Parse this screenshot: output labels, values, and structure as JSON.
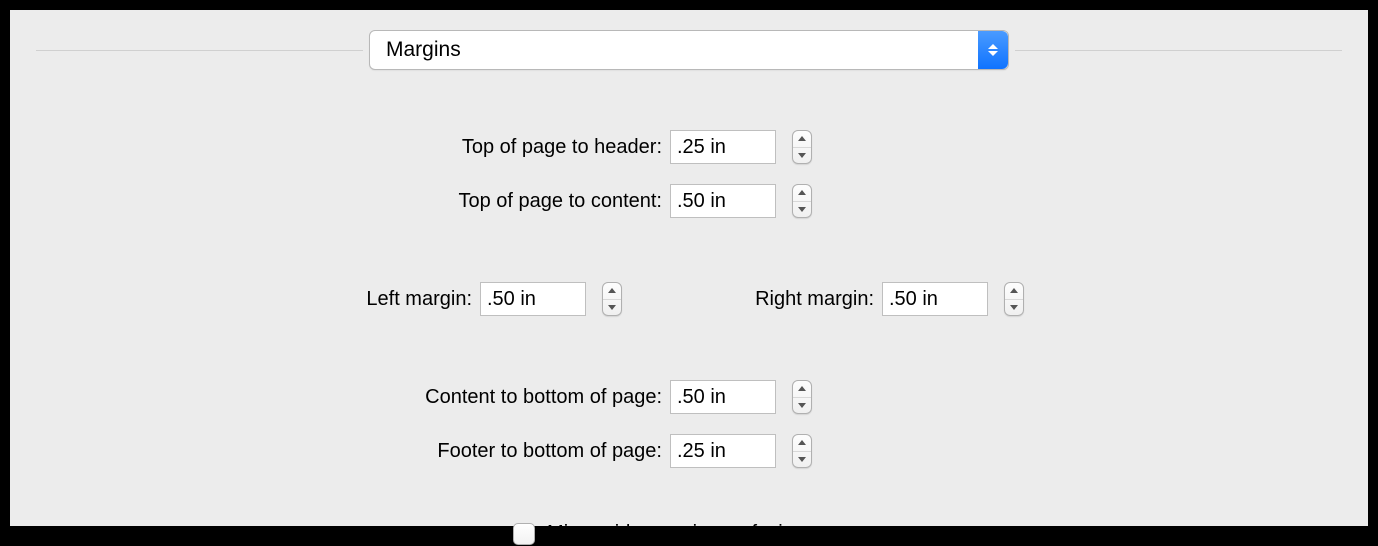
{
  "dropdown": {
    "selected": "Margins"
  },
  "fields": {
    "top_header": {
      "label": "Top of page to header:",
      "value": ".25 in"
    },
    "top_content": {
      "label": "Top of page to content:",
      "value": ".50 in"
    },
    "left_margin": {
      "label": "Left margin:",
      "value": ".50 in"
    },
    "right_margin": {
      "label": "Right margin:",
      "value": ".50 in"
    },
    "content_bottom": {
      "label": "Content to bottom of page:",
      "value": ".50 in"
    },
    "footer_bottom": {
      "label": "Footer to bottom of page:",
      "value": ".25 in"
    }
  },
  "checkbox": {
    "mirror_label": "Mirror side margins on facing pages",
    "checked": false
  }
}
